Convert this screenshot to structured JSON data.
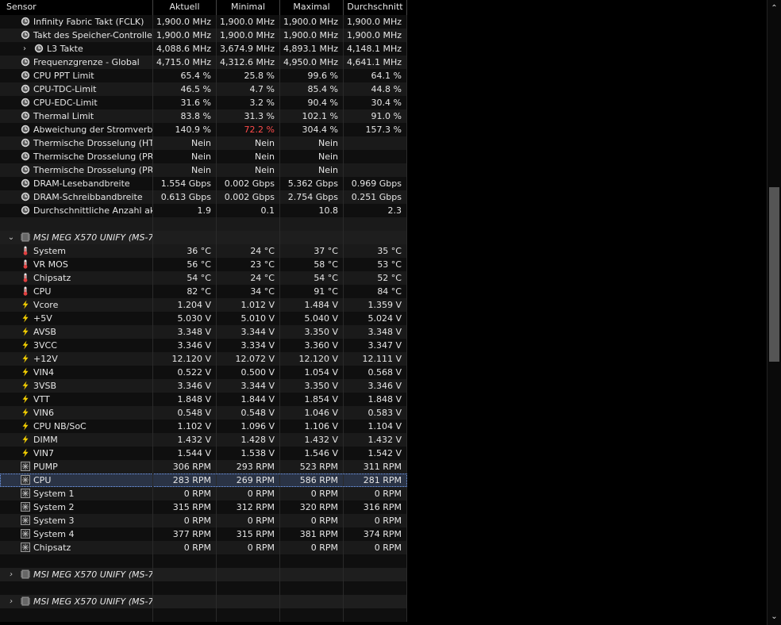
{
  "header": {
    "sensor": "Sensor",
    "current": "Aktuell",
    "min": "Minimal",
    "max": "Maximal",
    "avg": "Durchschnitt"
  },
  "rows": [
    {
      "icon": "clock",
      "indent": 1,
      "label": "Infinity Fabric Takt (FCLK)",
      "cur": "1,900.0 MHz",
      "min": "1,900.0 MHz",
      "max": "1,900.0 MHz",
      "avg": "1,900.0 MHz"
    },
    {
      "icon": "clock",
      "indent": 1,
      "label": "Takt des Speicher-Controlle…",
      "cur": "1,900.0 MHz",
      "min": "1,900.0 MHz",
      "max": "1,900.0 MHz",
      "avg": "1,900.0 MHz"
    },
    {
      "icon": "clock",
      "indent": 1,
      "expand": "collapsed",
      "label": "L3 Takte",
      "cur": "4,088.6 MHz",
      "min": "3,674.9 MHz",
      "max": "4,893.1 MHz",
      "avg": "4,148.1 MHz"
    },
    {
      "icon": "clock",
      "indent": 1,
      "label": "Frequenzgrenze - Global",
      "cur": "4,715.0 MHz",
      "min": "4,312.6 MHz",
      "max": "4,950.0 MHz",
      "avg": "4,641.1 MHz"
    },
    {
      "icon": "clock",
      "indent": 1,
      "label": "CPU PPT Limit",
      "cur": "65.4 %",
      "min": "25.8 %",
      "max": "99.6 %",
      "avg": "64.1 %"
    },
    {
      "icon": "clock",
      "indent": 1,
      "label": "CPU-TDC-Limit",
      "cur": "46.5 %",
      "min": "4.7 %",
      "max": "85.4 %",
      "avg": "44.8 %"
    },
    {
      "icon": "clock",
      "indent": 1,
      "label": "CPU-EDC-Limit",
      "cur": "31.6 %",
      "min": "3.2 %",
      "max": "90.4 %",
      "avg": "30.4 %"
    },
    {
      "icon": "clock",
      "indent": 1,
      "label": "Thermal Limit",
      "cur": "83.8 %",
      "min": "31.3 %",
      "max": "102.1 %",
      "avg": "91.0 %"
    },
    {
      "icon": "clock",
      "indent": 1,
      "label": "Abweichung der Stromverbr…",
      "cur": "140.9 %",
      "min": "72.2 %",
      "max": "304.4 %",
      "avg": "157.3 %",
      "min_red": true
    },
    {
      "icon": "clock",
      "indent": 1,
      "label": "Thermische Drosselung (HTC)",
      "cur": "Nein",
      "min": "Nein",
      "max": "Nein",
      "avg": ""
    },
    {
      "icon": "clock",
      "indent": 1,
      "label": "Thermische Drosselung (PR…",
      "cur": "Nein",
      "min": "Nein",
      "max": "Nein",
      "avg": ""
    },
    {
      "icon": "clock",
      "indent": 1,
      "label": "Thermische Drosselung (PR…",
      "cur": "Nein",
      "min": "Nein",
      "max": "Nein",
      "avg": ""
    },
    {
      "icon": "clock",
      "indent": 1,
      "label": "DRAM-Lesebandbreite",
      "cur": "1.554 Gbps",
      "min": "0.002 Gbps",
      "max": "5.362 Gbps",
      "avg": "0.969 Gbps"
    },
    {
      "icon": "clock",
      "indent": 1,
      "label": "DRAM-Schreibbandbreite",
      "cur": "0.613 Gbps",
      "min": "0.002 Gbps",
      "max": "2.754 Gbps",
      "avg": "0.251 Gbps"
    },
    {
      "icon": "clock",
      "indent": 1,
      "label": "Durchschnittliche Anzahl akt…",
      "cur": "1.9",
      "min": "0.1",
      "max": "10.8",
      "avg": "2.3"
    },
    {
      "blank": true
    },
    {
      "group": true,
      "expand": "expanded",
      "icon": "chip",
      "label": "MSI MEG X570 UNIFY (MS-7…"
    },
    {
      "icon": "thermo",
      "indent": 1,
      "label": "System",
      "cur": "36 °C",
      "min": "24 °C",
      "max": "37 °C",
      "avg": "35 °C"
    },
    {
      "icon": "thermo",
      "indent": 1,
      "label": "VR MOS",
      "cur": "56 °C",
      "min": "23 °C",
      "max": "58 °C",
      "avg": "53 °C"
    },
    {
      "icon": "thermo",
      "indent": 1,
      "label": "Chipsatz",
      "cur": "54 °C",
      "min": "24 °C",
      "max": "54 °C",
      "avg": "52 °C"
    },
    {
      "icon": "thermo",
      "indent": 1,
      "label": "CPU",
      "cur": "82 °C",
      "min": "34 °C",
      "max": "91 °C",
      "avg": "84 °C"
    },
    {
      "icon": "bolt",
      "indent": 1,
      "label": "Vcore",
      "cur": "1.204 V",
      "min": "1.012 V",
      "max": "1.484 V",
      "avg": "1.359 V"
    },
    {
      "icon": "bolt",
      "indent": 1,
      "label": "+5V",
      "cur": "5.030 V",
      "min": "5.010 V",
      "max": "5.040 V",
      "avg": "5.024 V"
    },
    {
      "icon": "bolt",
      "indent": 1,
      "label": "AVSB",
      "cur": "3.348 V",
      "min": "3.344 V",
      "max": "3.350 V",
      "avg": "3.348 V"
    },
    {
      "icon": "bolt",
      "indent": 1,
      "label": "3VCC",
      "cur": "3.346 V",
      "min": "3.334 V",
      "max": "3.360 V",
      "avg": "3.347 V"
    },
    {
      "icon": "bolt",
      "indent": 1,
      "label": "+12V",
      "cur": "12.120 V",
      "min": "12.072 V",
      "max": "12.120 V",
      "avg": "12.111 V"
    },
    {
      "icon": "bolt",
      "indent": 1,
      "label": "VIN4",
      "cur": "0.522 V",
      "min": "0.500 V",
      "max": "1.054 V",
      "avg": "0.568 V"
    },
    {
      "icon": "bolt",
      "indent": 1,
      "label": "3VSB",
      "cur": "3.346 V",
      "min": "3.344 V",
      "max": "3.350 V",
      "avg": "3.346 V"
    },
    {
      "icon": "bolt",
      "indent": 1,
      "label": "VTT",
      "cur": "1.848 V",
      "min": "1.844 V",
      "max": "1.854 V",
      "avg": "1.848 V"
    },
    {
      "icon": "bolt",
      "indent": 1,
      "label": "VIN6",
      "cur": "0.548 V",
      "min": "0.548 V",
      "max": "1.046 V",
      "avg": "0.583 V"
    },
    {
      "icon": "bolt",
      "indent": 1,
      "label": "CPU NB/SoC",
      "cur": "1.102 V",
      "min": "1.096 V",
      "max": "1.106 V",
      "avg": "1.104 V"
    },
    {
      "icon": "bolt",
      "indent": 1,
      "label": "DIMM",
      "cur": "1.432 V",
      "min": "1.428 V",
      "max": "1.432 V",
      "avg": "1.432 V"
    },
    {
      "icon": "bolt",
      "indent": 1,
      "label": "VIN7",
      "cur": "1.544 V",
      "min": "1.538 V",
      "max": "1.546 V",
      "avg": "1.542 V"
    },
    {
      "icon": "fan",
      "indent": 1,
      "label": "PUMP",
      "cur": "306 RPM",
      "min": "293 RPM",
      "max": "523 RPM",
      "avg": "311 RPM"
    },
    {
      "icon": "fan",
      "indent": 1,
      "label": "CPU",
      "cur": "283 RPM",
      "min": "269 RPM",
      "max": "586 RPM",
      "avg": "281 RPM",
      "selected": true
    },
    {
      "icon": "fan",
      "indent": 1,
      "label": "System 1",
      "cur": "0 RPM",
      "min": "0 RPM",
      "max": "0 RPM",
      "avg": "0 RPM"
    },
    {
      "icon": "fan",
      "indent": 1,
      "label": "System 2",
      "cur": "315 RPM",
      "min": "312 RPM",
      "max": "320 RPM",
      "avg": "316 RPM"
    },
    {
      "icon": "fan",
      "indent": 1,
      "label": "System 3",
      "cur": "0 RPM",
      "min": "0 RPM",
      "max": "0 RPM",
      "avg": "0 RPM"
    },
    {
      "icon": "fan",
      "indent": 1,
      "label": "System 4",
      "cur": "377 RPM",
      "min": "315 RPM",
      "max": "381 RPM",
      "avg": "374 RPM"
    },
    {
      "icon": "fan",
      "indent": 1,
      "label": "Chipsatz",
      "cur": "0 RPM",
      "min": "0 RPM",
      "max": "0 RPM",
      "avg": "0 RPM"
    },
    {
      "blank": true
    },
    {
      "group": true,
      "expand": "collapsed",
      "icon": "chip",
      "label": "MSI MEG X570 UNIFY (MS-7…"
    },
    {
      "blank": true
    },
    {
      "group": true,
      "expand": "collapsed",
      "icon": "chip",
      "label": "MSI MEG X570 UNIFY (MS-7…"
    },
    {
      "blank": true
    }
  ],
  "scrollbar": {
    "up_icon": "chevron-up-icon",
    "down_icon": "chevron-down-icon"
  },
  "colors": {
    "bolt": "#f5d000",
    "thermo_fill": "#e04040",
    "red_value": "#ff4b4b",
    "selection": "#7aa7ff"
  }
}
